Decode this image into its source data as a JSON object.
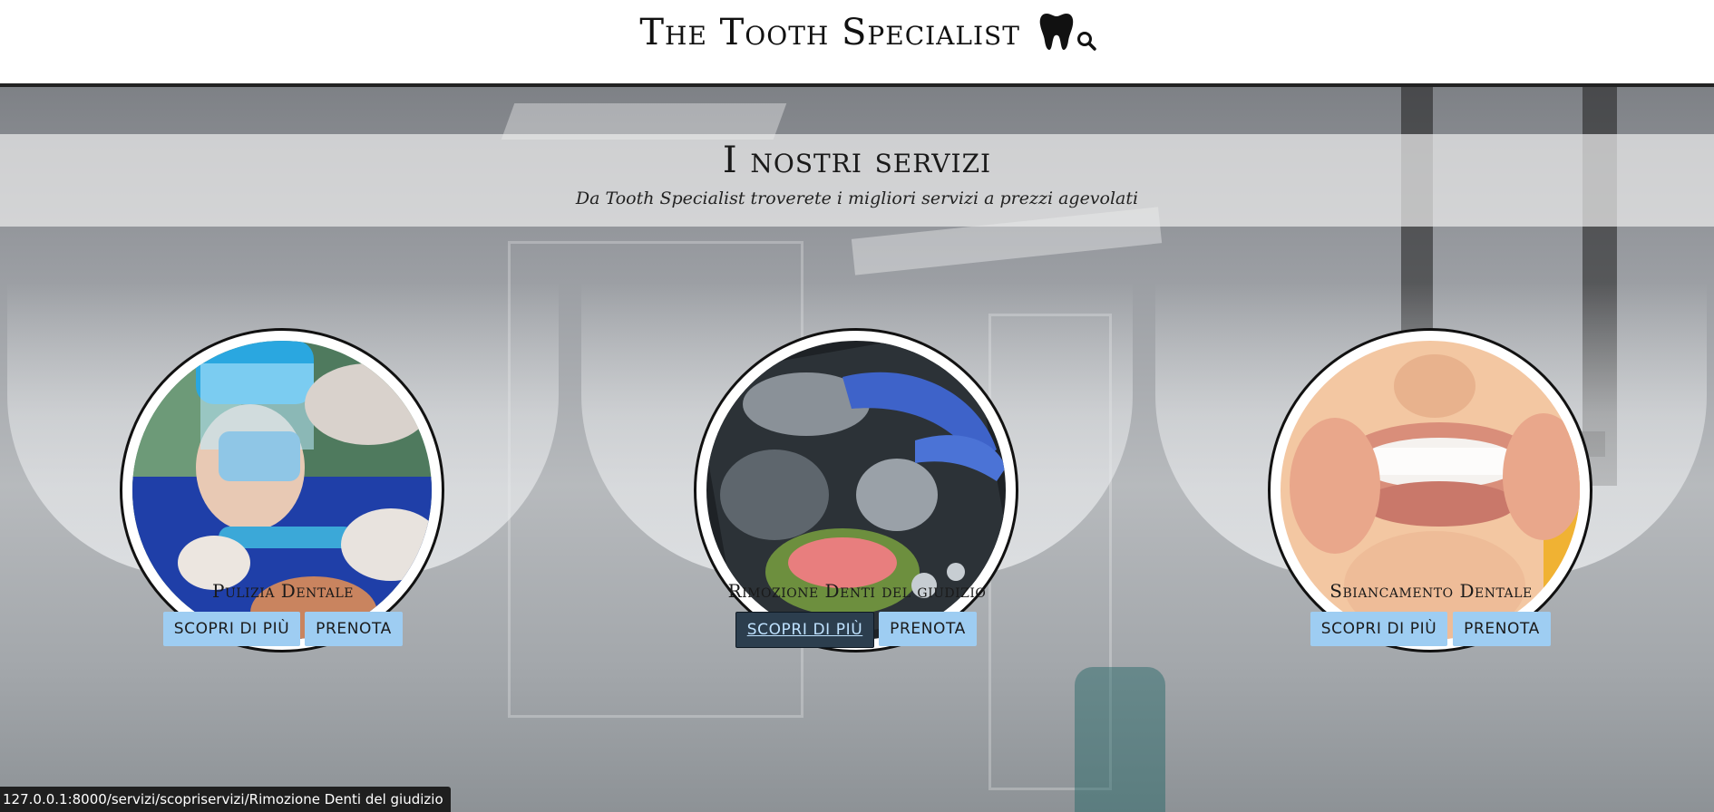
{
  "header": {
    "brand": "The Tooth Specialist",
    "logo_icon": "tooth-icon",
    "search_icon": "search-icon"
  },
  "hero": {
    "title": "I nostri servizi",
    "subtitle": "Da Tooth Specialist troverete i migliori servizi a prezzi agevolati"
  },
  "services": [
    {
      "title": "Pulizia Dentale",
      "more_label": "SCOPRI DI PIÙ",
      "book_label": "PRENOTA",
      "image": "dental-cleaning-photo"
    },
    {
      "title": "Rimozione Denti del giudizio",
      "more_label": "SCOPRI DI PIÙ",
      "book_label": "PRENOTA",
      "image": "dental-xray-photo"
    },
    {
      "title": "Sbiancamento Dentale",
      "more_label": "SCOPRI DI PIÙ",
      "book_label": "PRENOTA",
      "image": "teeth-aligner-photo"
    }
  ],
  "status_bar": {
    "url": "127.0.0.1:8000/servizi/scopriservizi/Rimozione Denti del giudizio"
  },
  "colors": {
    "button_bg": "#9ecdf2",
    "button_active_bg": "#2c3e4e",
    "header_border": "#222222"
  }
}
